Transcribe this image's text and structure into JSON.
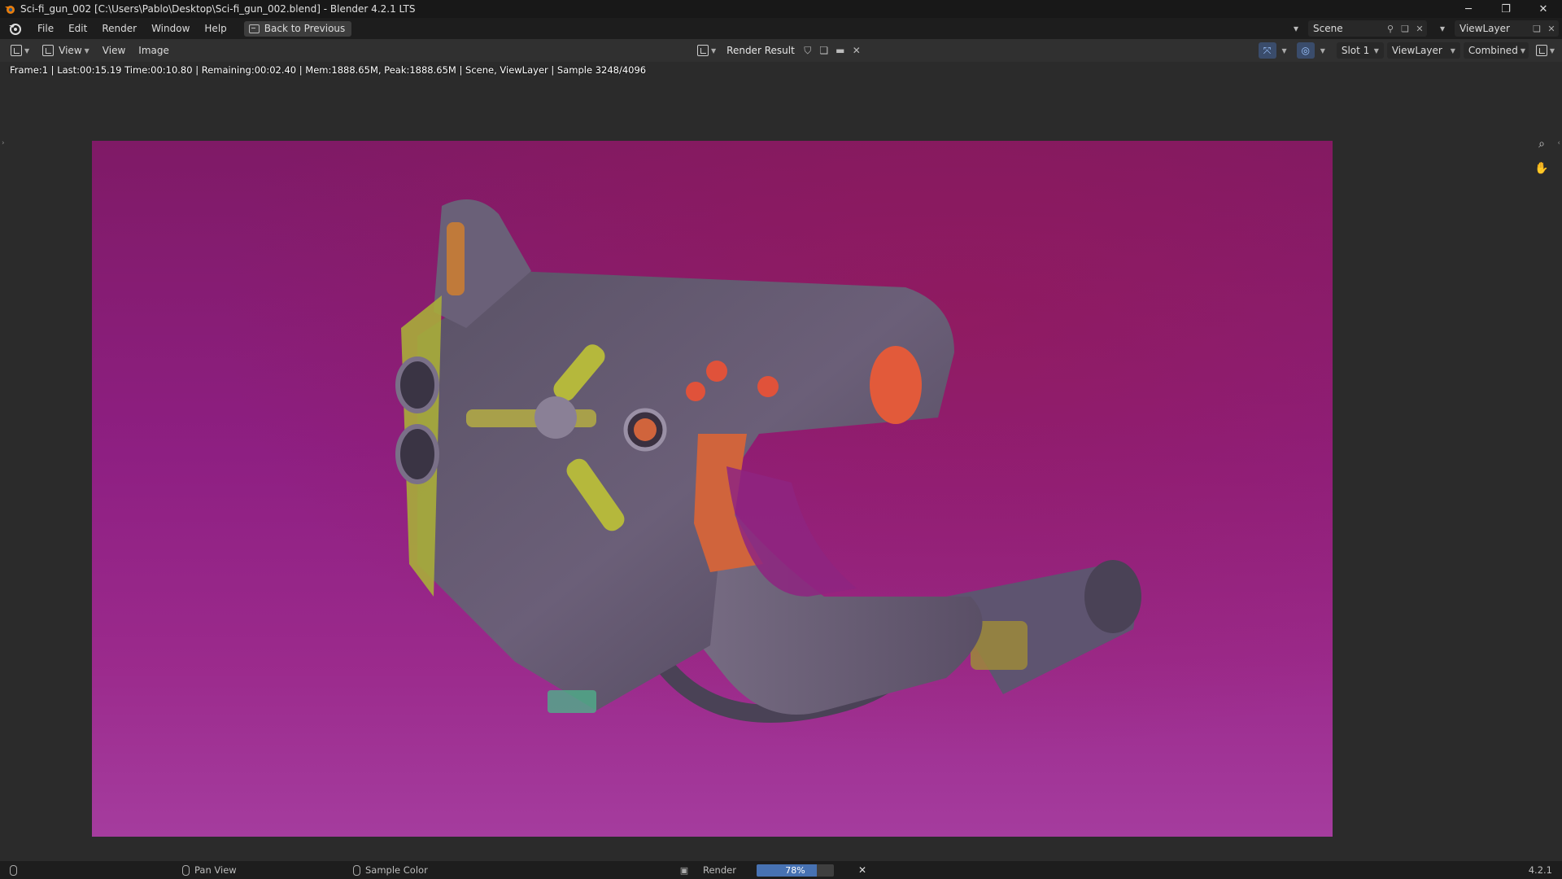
{
  "window": {
    "title": "Sci-fi_gun_002 [C:\\Users\\Pablo\\Desktop\\Sci-fi_gun_002.blend] - Blender 4.2.1 LTS",
    "controls": [
      "─",
      "❐",
      "✕"
    ]
  },
  "menubar": {
    "items": [
      "File",
      "Edit",
      "Render",
      "Window",
      "Help"
    ],
    "back_button": "Back to Previous",
    "scene_label": "Scene",
    "viewlayer_label": "ViewLayer"
  },
  "editor_header": {
    "view_dropdown": "View",
    "menus": [
      "View",
      "Image"
    ],
    "image_name": "Render Result",
    "slot": "Slot 1",
    "view_layer": "ViewLayer",
    "pass": "Combined"
  },
  "info_line": "Frame:1 | Last:00:15.19 Time:00:10.80 | Remaining:00:02.40 | Mem:1888.65M, Peak:1888.65M | Scene, ViewLayer | Sample 3248/4096",
  "statusbar": {
    "pan_view": "Pan View",
    "sample_color": "Sample Color",
    "render_label": "Render",
    "progress_text": "78%",
    "progress_value": 0.78,
    "version": "4.2.1"
  },
  "colors": {
    "accent": "#4772b3",
    "render_bg_top": "#7f1a66",
    "render_bg_bottom": "#a53c9e"
  }
}
